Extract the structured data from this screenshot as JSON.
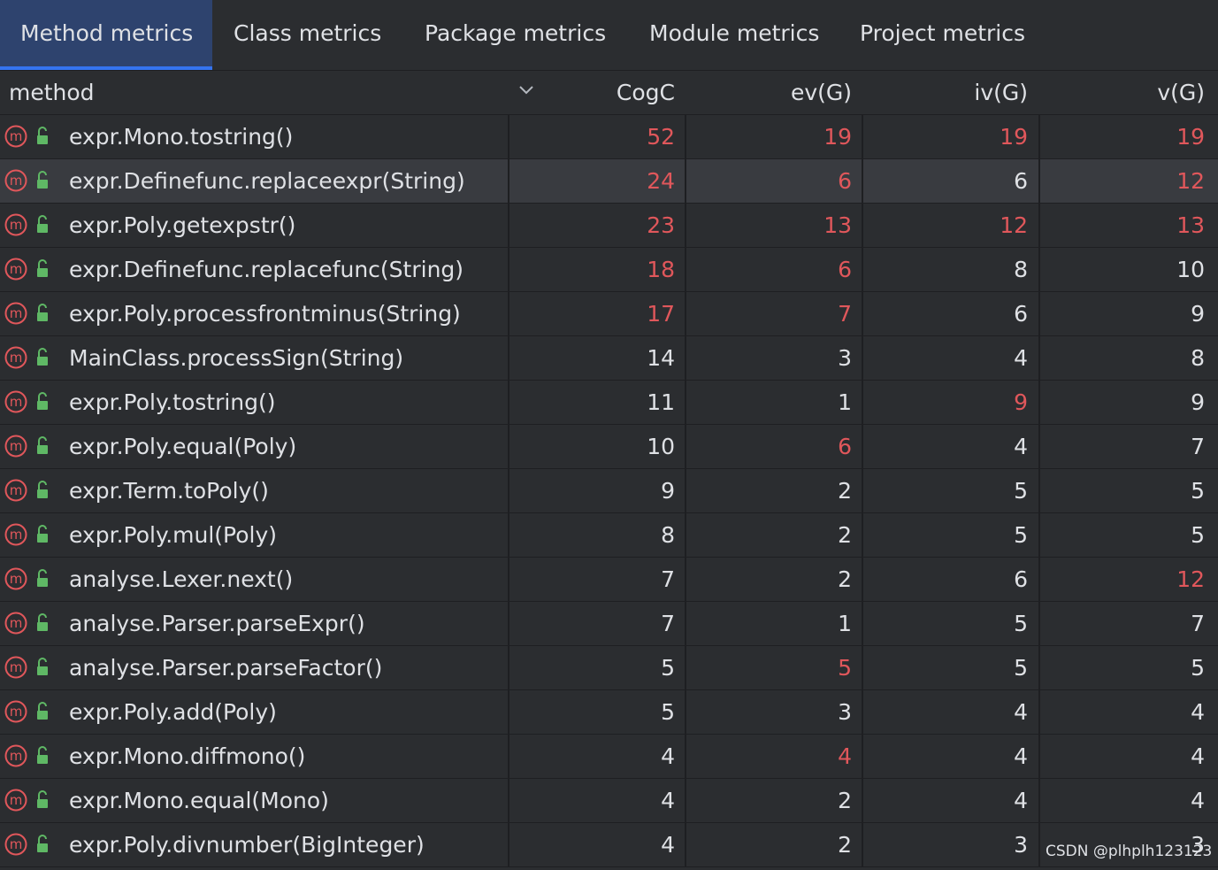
{
  "tabs": [
    {
      "label": "Method metrics",
      "active": true
    },
    {
      "label": "Class metrics",
      "active": false
    },
    {
      "label": "Package metrics",
      "active": false
    },
    {
      "label": "Module metrics",
      "active": false
    },
    {
      "label": "Project metrics",
      "active": false
    }
  ],
  "columns": {
    "method": "method",
    "cogc": "CogC",
    "evg": "ev(G)",
    "ivg": "iv(G)",
    "vg": "v(G)"
  },
  "colors": {
    "accent": "#3574f0",
    "active_tab_bg": "#2e436e",
    "warning_red": "#e0575b",
    "text": "#dfe1e5",
    "selected_row_bg": "#393b40",
    "lock_green": "#5fb865"
  },
  "icons": {
    "method": "method-m-icon",
    "visibility": "public-unlock-icon",
    "sort": "chevron-down-icon"
  },
  "rows": [
    {
      "method": "expr.Mono.tostring()",
      "cogc": "52",
      "evg": "19",
      "ivg": "19",
      "vg": "19",
      "red": [
        true,
        true,
        true,
        true
      ],
      "selected": false
    },
    {
      "method": "expr.Definefunc.replaceexpr(String)",
      "cogc": "24",
      "evg": "6",
      "ivg": "6",
      "vg": "12",
      "red": [
        true,
        true,
        false,
        true
      ],
      "selected": true
    },
    {
      "method": "expr.Poly.getexpstr()",
      "cogc": "23",
      "evg": "13",
      "ivg": "12",
      "vg": "13",
      "red": [
        true,
        true,
        true,
        true
      ],
      "selected": false
    },
    {
      "method": "expr.Definefunc.replacefunc(String)",
      "cogc": "18",
      "evg": "6",
      "ivg": "8",
      "vg": "10",
      "red": [
        true,
        true,
        false,
        false
      ],
      "selected": false
    },
    {
      "method": "expr.Poly.processfrontminus(String)",
      "cogc": "17",
      "evg": "7",
      "ivg": "6",
      "vg": "9",
      "red": [
        true,
        true,
        false,
        false
      ],
      "selected": false
    },
    {
      "method": "MainClass.processSign(String)",
      "cogc": "14",
      "evg": "3",
      "ivg": "4",
      "vg": "8",
      "red": [
        false,
        false,
        false,
        false
      ],
      "selected": false
    },
    {
      "method": "expr.Poly.tostring()",
      "cogc": "11",
      "evg": "1",
      "ivg": "9",
      "vg": "9",
      "red": [
        false,
        false,
        true,
        false
      ],
      "selected": false
    },
    {
      "method": "expr.Poly.equal(Poly)",
      "cogc": "10",
      "evg": "6",
      "ivg": "4",
      "vg": "7",
      "red": [
        false,
        true,
        false,
        false
      ],
      "selected": false
    },
    {
      "method": "expr.Term.toPoly()",
      "cogc": "9",
      "evg": "2",
      "ivg": "5",
      "vg": "5",
      "red": [
        false,
        false,
        false,
        false
      ],
      "selected": false
    },
    {
      "method": "expr.Poly.mul(Poly)",
      "cogc": "8",
      "evg": "2",
      "ivg": "5",
      "vg": "5",
      "red": [
        false,
        false,
        false,
        false
      ],
      "selected": false
    },
    {
      "method": "analyse.Lexer.next()",
      "cogc": "7",
      "evg": "2",
      "ivg": "6",
      "vg": "12",
      "red": [
        false,
        false,
        false,
        true
      ],
      "selected": false
    },
    {
      "method": "analyse.Parser.parseExpr()",
      "cogc": "7",
      "evg": "1",
      "ivg": "5",
      "vg": "7",
      "red": [
        false,
        false,
        false,
        false
      ],
      "selected": false
    },
    {
      "method": "analyse.Parser.parseFactor()",
      "cogc": "5",
      "evg": "5",
      "ivg": "5",
      "vg": "5",
      "red": [
        false,
        true,
        false,
        false
      ],
      "selected": false
    },
    {
      "method": "expr.Poly.add(Poly)",
      "cogc": "5",
      "evg": "3",
      "ivg": "4",
      "vg": "4",
      "red": [
        false,
        false,
        false,
        false
      ],
      "selected": false
    },
    {
      "method": "expr.Mono.diffmono()",
      "cogc": "4",
      "evg": "4",
      "ivg": "4",
      "vg": "4",
      "red": [
        false,
        true,
        false,
        false
      ],
      "selected": false
    },
    {
      "method": "expr.Mono.equal(Mono)",
      "cogc": "4",
      "evg": "2",
      "ivg": "4",
      "vg": "4",
      "red": [
        false,
        false,
        false,
        false
      ],
      "selected": false
    },
    {
      "method": "expr.Poly.divnumber(BigInteger)",
      "cogc": "4",
      "evg": "2",
      "ivg": "3",
      "vg": "3",
      "red": [
        false,
        false,
        false,
        false
      ],
      "selected": false
    }
  ],
  "watermark": "CSDN @plhplh123123"
}
